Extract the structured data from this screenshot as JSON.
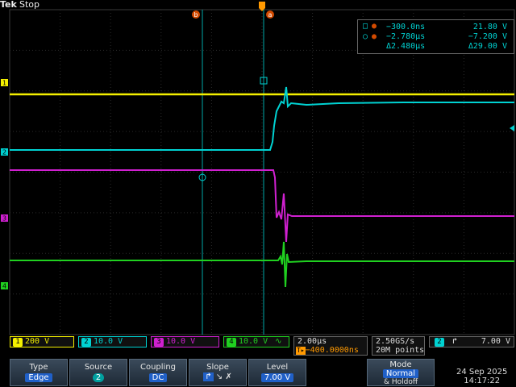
{
  "header": {
    "brand": "Tek",
    "state": "Stop"
  },
  "cursor_readout": {
    "row1": {
      "t": "−300.0ns",
      "v": "21.80 V"
    },
    "row2": {
      "t": "−2.780µs",
      "v": "−7.200 V"
    },
    "row3": {
      "t": "Δ2.480µs",
      "v": "Δ29.00 V"
    }
  },
  "markers": {
    "a": "a",
    "b": "b"
  },
  "channels": [
    {
      "num": "1",
      "scale": "200 V",
      "color": "#f4f000"
    },
    {
      "num": "2",
      "scale": "10.0 V",
      "color": "#00d2d2"
    },
    {
      "num": "3",
      "scale": "10.0 V",
      "color": "#d020d0"
    },
    {
      "num": "4",
      "scale": "10.0 V",
      "color": "#20d020"
    }
  ],
  "channel_markers": [
    "1",
    "2",
    "3",
    "4"
  ],
  "timebase": {
    "scale": "2.00µs",
    "position": "−400.0000ns"
  },
  "acquisition": {
    "rate": "2.50GS/s",
    "points": "20M points"
  },
  "trigger": {
    "channel": "2",
    "level": "7.00 V"
  },
  "menu": {
    "type": {
      "label": "Type",
      "value": "Edge"
    },
    "source": {
      "label": "Source",
      "value": "2"
    },
    "coupling": {
      "label": "Coupling",
      "value": "DC"
    },
    "slope": {
      "label": "Slope"
    },
    "level": {
      "label": "Level",
      "value": "7.00 V"
    },
    "mode": {
      "label": "Mode",
      "value": "Normal",
      "extra": "& Holdoff"
    }
  },
  "datetime": {
    "date": "24 Sep 2025",
    "time": "14:17:22"
  },
  "colors": {
    "grid": "#3a3a3a",
    "ch1": "#f4f000",
    "ch2": "#00d2d2",
    "ch3": "#d020d0",
    "ch4": "#20d020",
    "cursor": "#00b0b0",
    "trigger": "#ff9900"
  }
}
